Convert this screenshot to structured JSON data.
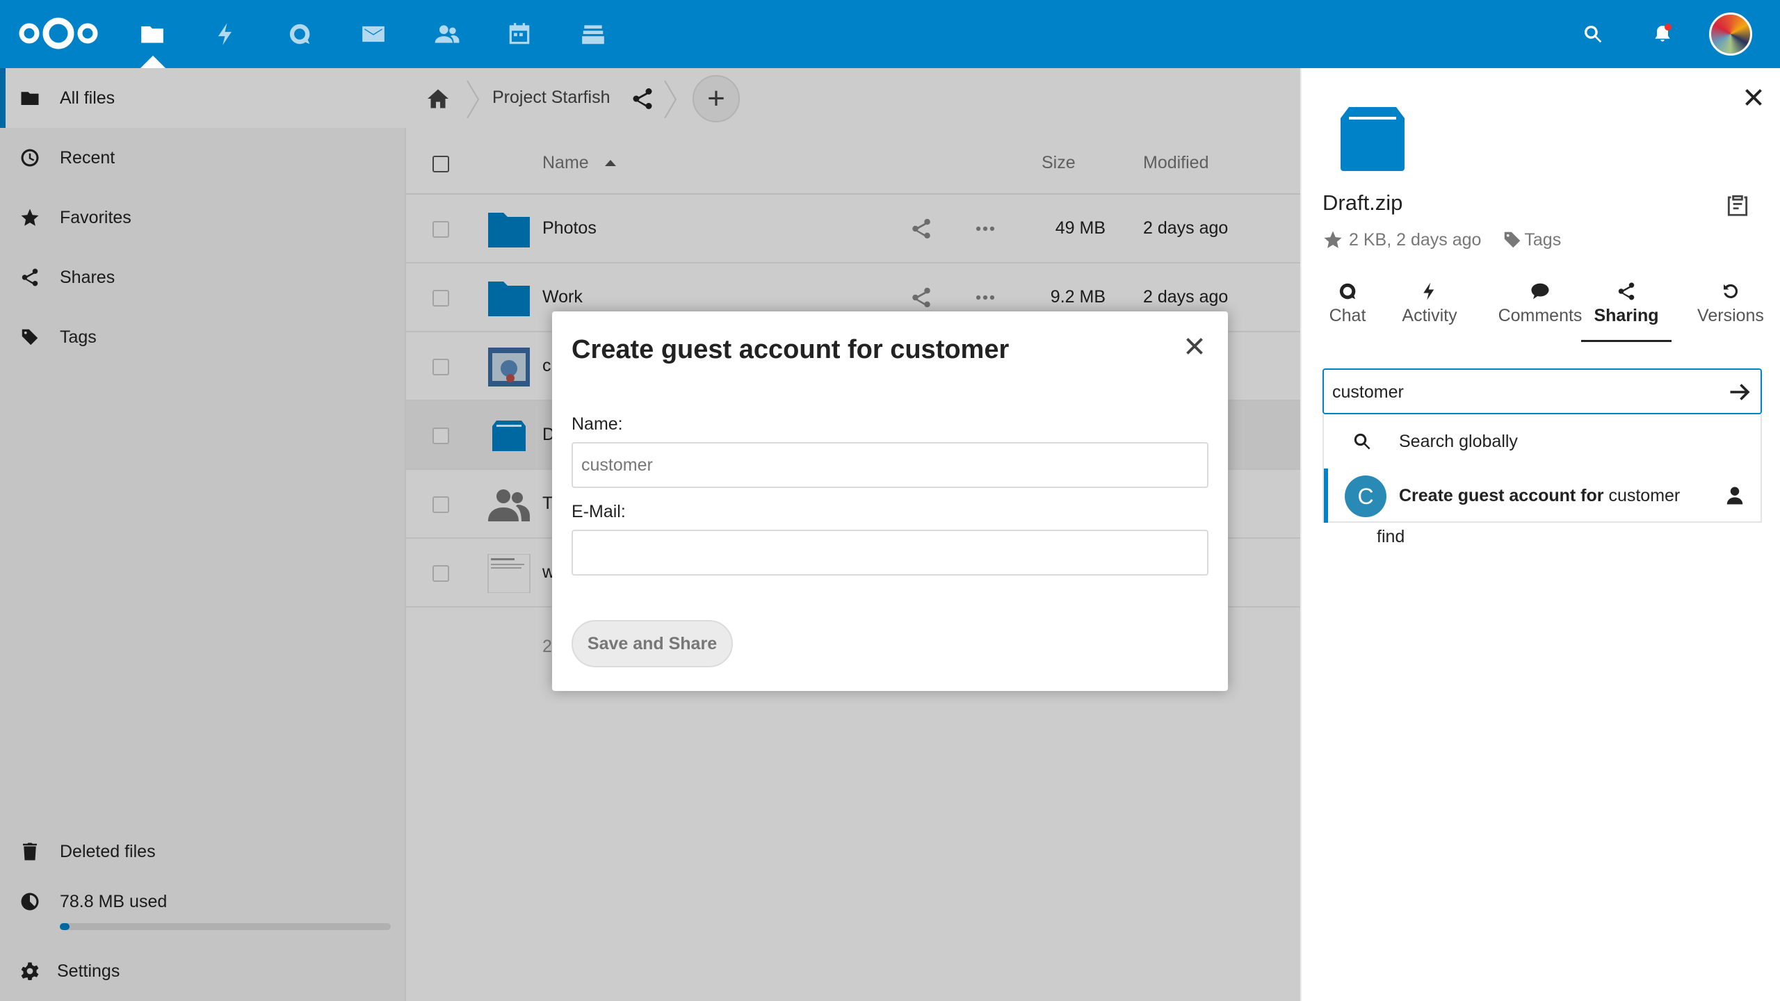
{
  "header": {
    "apps": [
      {
        "name": "files"
      },
      {
        "name": "activity"
      },
      {
        "name": "talk"
      },
      {
        "name": "mail"
      },
      {
        "name": "contacts"
      },
      {
        "name": "calendar"
      },
      {
        "name": "deck"
      }
    ],
    "accent": "#0082c9"
  },
  "nav": {
    "items": [
      {
        "label": "All files",
        "icon": "folder-icon"
      },
      {
        "label": "Recent",
        "icon": "clock-icon"
      },
      {
        "label": "Favorites",
        "icon": "star-icon"
      },
      {
        "label": "Shares",
        "icon": "share-icon"
      },
      {
        "label": "Tags",
        "icon": "tag-icon"
      }
    ],
    "deleted": "Deleted files",
    "quota": "78.8 MB used",
    "quota_fraction": 0.03,
    "settings": "Settings"
  },
  "files": {
    "breadcrumb": "Project Starfish",
    "new_button": "+",
    "columns": {
      "name": "Name",
      "size": "Size",
      "modified": "Modified"
    },
    "rows": [
      {
        "name": "Photos",
        "size": "49 MB",
        "modified": "2 days ago",
        "type": "folder"
      },
      {
        "name": "Work",
        "size": "9.2 MB",
        "modified": "2 days ago",
        "type": "folder"
      },
      {
        "name": "c",
        "size": "",
        "modified": "",
        "type": "image"
      },
      {
        "name": "D",
        "size": "",
        "modified": "",
        "type": "archive"
      },
      {
        "name": "T",
        "size": "",
        "modified": "",
        "type": "group"
      },
      {
        "name": "w",
        "size": "",
        "modified": "",
        "type": "document"
      }
    ],
    "summary": "2"
  },
  "sidebar": {
    "filename": "Draft.zip",
    "meta": "2 KB, 2 days ago",
    "tags": "Tags",
    "tabs": [
      {
        "label": "Chat"
      },
      {
        "label": "Activity"
      },
      {
        "label": "Comments"
      },
      {
        "label": "Sharing"
      },
      {
        "label": "Versions"
      }
    ],
    "share_input": "customer",
    "dropdown": {
      "search_globally": "Search globally",
      "create_guest_prefix": "Create guest account for ",
      "create_guest_name": "customer",
      "avatar_letter": "C",
      "find": "find"
    }
  },
  "modal": {
    "title": "Create guest account for customer",
    "name_label": "Name:",
    "name_value": "customer",
    "email_label": "E-Mail:",
    "email_value": "",
    "save_button": "Save and Share"
  }
}
